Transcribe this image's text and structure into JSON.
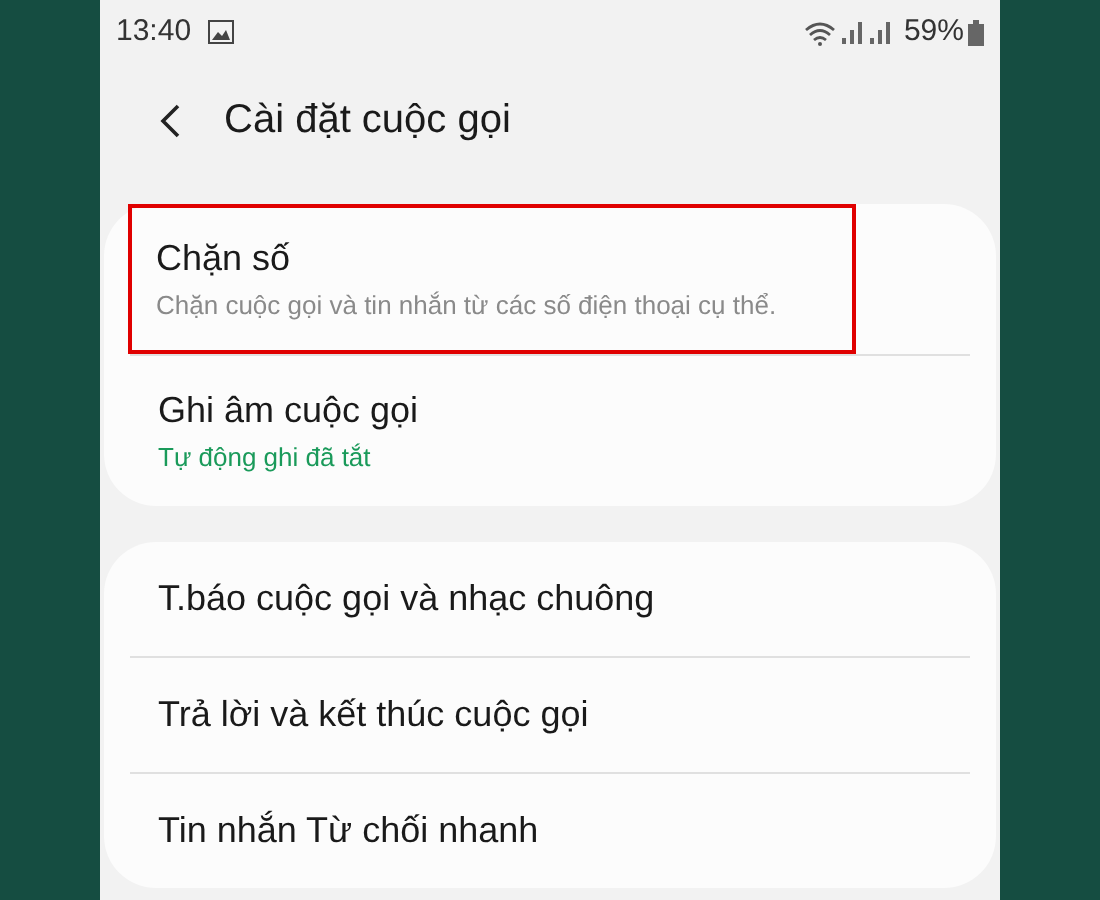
{
  "status_bar": {
    "time": "13:40",
    "battery": "59%"
  },
  "header": {
    "title": "Cài đặt cuộc gọi"
  },
  "groups": [
    {
      "items": [
        {
          "title": "Chặn số",
          "subtitle": "Chặn cuộc gọi và tin nhắn từ các số điện thoại cụ thể.",
          "kind": "description",
          "highlighted": true
        },
        {
          "title": "Ghi âm cuộc gọi",
          "subtitle": "Tự động ghi đã tắt",
          "kind": "status",
          "highlighted": false
        }
      ]
    },
    {
      "items": [
        {
          "title": "T.báo cuộc gọi và nhạc chuông",
          "kind": "plain",
          "highlighted": false
        },
        {
          "title": "Trả lời và kết thúc cuộc gọi",
          "kind": "plain",
          "highlighted": false
        },
        {
          "title": "Tin nhắn Từ chối nhanh",
          "kind": "plain",
          "highlighted": false
        }
      ]
    }
  ]
}
